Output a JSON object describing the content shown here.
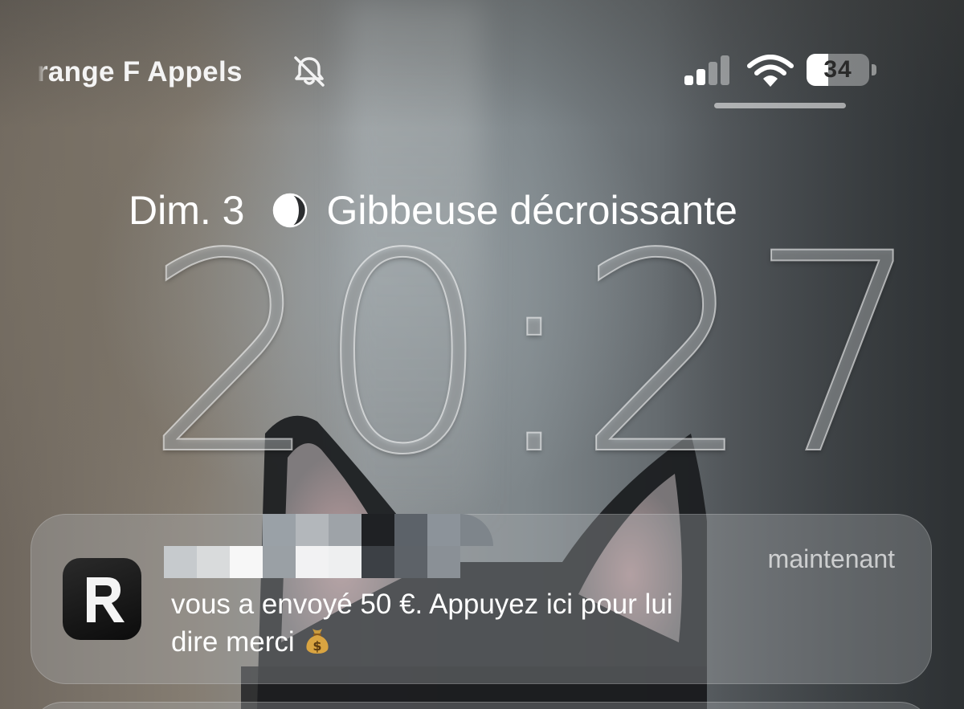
{
  "status_bar": {
    "carrier_text": "range F Appels",
    "battery_level": "34",
    "battery_fraction": 0.34,
    "icons": [
      "bell-slash-icon",
      "cellular-signal-icon",
      "wifi-icon",
      "battery-icon"
    ]
  },
  "lock_screen": {
    "date": "Dim. 3",
    "moon_phase": "Gibbeuse décroissante",
    "time": "20:27"
  },
  "notification": {
    "app_icon": "revolut-icon",
    "time": "maintenant",
    "body_line1": "vous a envoyé 50 €. Appuyez ici pour lui",
    "body_line2": "dire merci",
    "emoji": "money-bag-icon"
  },
  "colors": {
    "text": "#ffffff",
    "notification_bg": "rgba(175,180,182,0.33)"
  }
}
